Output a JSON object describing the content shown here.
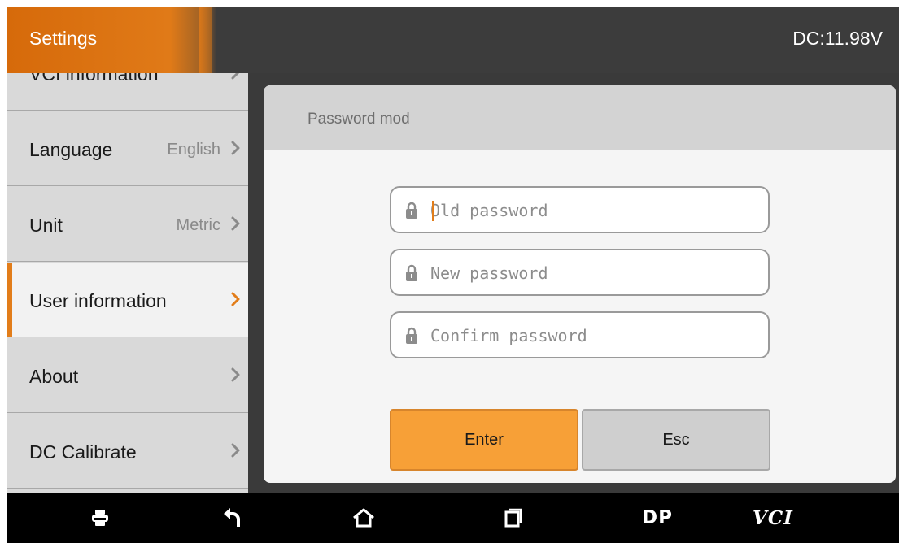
{
  "header": {
    "title": "Settings",
    "voltage": "DC:11.98V",
    "accent_color": "#e27d1a"
  },
  "sidebar": {
    "items": [
      {
        "label": "VCI information",
        "value": "",
        "icon": "chevron-right-icon",
        "active": false
      },
      {
        "label": "Language",
        "value": "English",
        "icon": "chevron-right-icon",
        "active": false
      },
      {
        "label": "Unit",
        "value": "Metric",
        "icon": "chevron-right-icon",
        "active": false
      },
      {
        "label": "User information",
        "value": "",
        "icon": "chevron-right-icon",
        "active": true
      },
      {
        "label": "About",
        "value": "",
        "icon": "chevron-right-icon",
        "active": false
      },
      {
        "label": "DC Calibrate",
        "value": "",
        "icon": "chevron-right-icon",
        "active": false
      }
    ]
  },
  "dialog": {
    "title": "Password mod",
    "fields": [
      {
        "placeholder": "Old password",
        "value": "",
        "icon": "lock-icon"
      },
      {
        "placeholder": "New password",
        "value": "",
        "icon": "lock-icon"
      },
      {
        "placeholder": "Confirm password",
        "value": "",
        "icon": "lock-icon"
      }
    ],
    "enter_label": "Enter",
    "esc_label": "Esc",
    "enter_color": "#f7a037"
  },
  "navbar": {
    "items": [
      {
        "icon": "printer-icon"
      },
      {
        "icon": "back-icon"
      },
      {
        "icon": "home-icon"
      },
      {
        "icon": "recent-apps-icon"
      },
      {
        "label": "DP"
      },
      {
        "label": "VCI"
      }
    ]
  }
}
